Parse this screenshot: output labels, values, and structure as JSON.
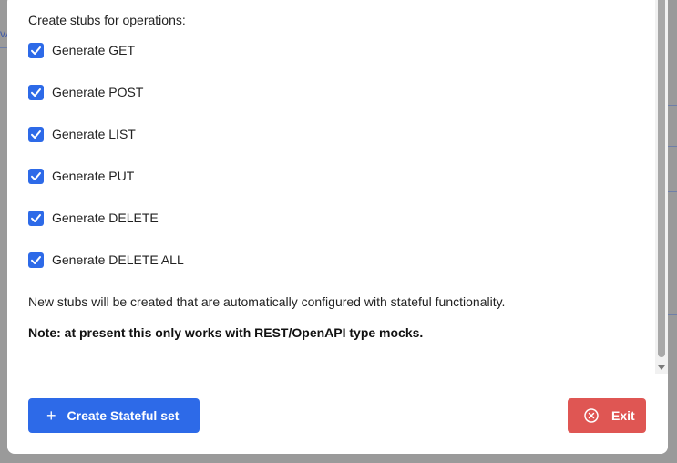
{
  "background": {
    "left_fragment": "vA"
  },
  "dialog": {
    "heading": "Create stubs for operations:",
    "options": [
      {
        "label": "Generate GET",
        "checked": true
      },
      {
        "label": "Generate POST",
        "checked": true
      },
      {
        "label": "Generate LIST",
        "checked": true
      },
      {
        "label": "Generate PUT",
        "checked": true
      },
      {
        "label": "Generate DELETE",
        "checked": true
      },
      {
        "label": "Generate DELETE ALL",
        "checked": true
      }
    ],
    "description": "New stubs will be created that are automatically configured with stateful functionality.",
    "note": "Note: at present this only works with REST/OpenAPI type mocks.",
    "create_button": {
      "label": "Create Stateful set",
      "icon": "plus-icon"
    },
    "exit_button": {
      "label": "Exit",
      "icon": "close-circle-icon"
    }
  },
  "colors": {
    "primary": "#2d6ae8",
    "danger": "#df5653"
  }
}
